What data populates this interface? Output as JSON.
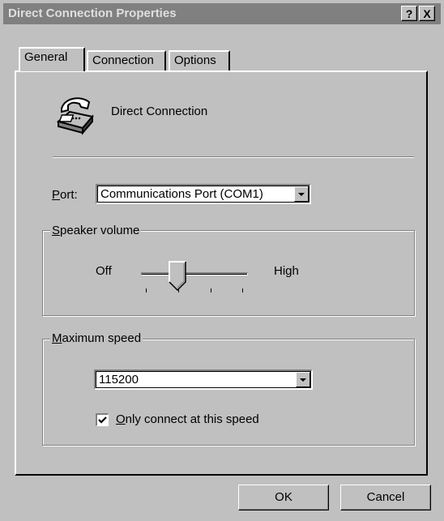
{
  "window": {
    "title": "Direct Connection Properties",
    "help_label": "?",
    "close_label": "X"
  },
  "tabs": [
    {
      "label": "General",
      "active": true
    },
    {
      "label": "Connection",
      "active": false
    },
    {
      "label": "Options",
      "active": false
    }
  ],
  "general": {
    "connection_name": "Direct Connection",
    "connection_icon": "telephone-icon",
    "port": {
      "label_mnemonic": "P",
      "label_rest": "ort:",
      "value": "Communications Port (COM1)"
    },
    "speaker_volume": {
      "title_mnemonic": "S",
      "title_rest": "peaker volume",
      "min_label": "Off",
      "max_label": "High",
      "level_step": 1,
      "steps": 4
    },
    "maximum_speed": {
      "title_mnemonic": "M",
      "title_rest": "aximum speed",
      "value": "115200",
      "only_connect": {
        "checked": true,
        "label_mnemonic": "O",
        "label_rest": "nly connect at this speed"
      }
    }
  },
  "buttons": {
    "ok": "OK",
    "cancel": "Cancel"
  }
}
